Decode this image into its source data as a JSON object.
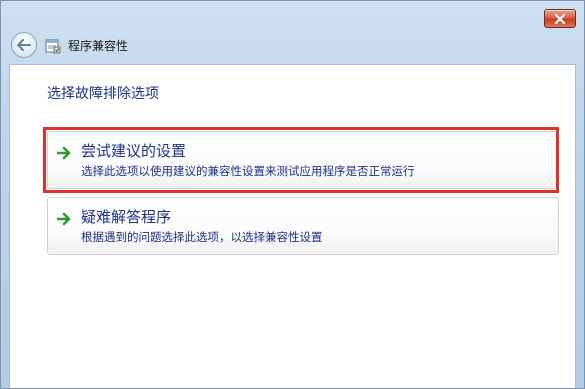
{
  "window": {
    "title": "程序兼容性"
  },
  "main": {
    "heading": "选择故障排除选项",
    "options": [
      {
        "title": "尝试建议的设置",
        "description": "选择此选项以使用建议的兼容性设置来测试应用程序是否正常运行",
        "icon": "green-arrow-icon"
      },
      {
        "title": "疑难解答程序",
        "description": "根据遇到的问题选择此选项，以选择兼容性设置",
        "icon": "green-arrow-icon"
      }
    ]
  },
  "colors": {
    "link_blue": "#1e3287",
    "highlight_red": "#e0302c",
    "arrow_green": "#2e9a2e"
  }
}
